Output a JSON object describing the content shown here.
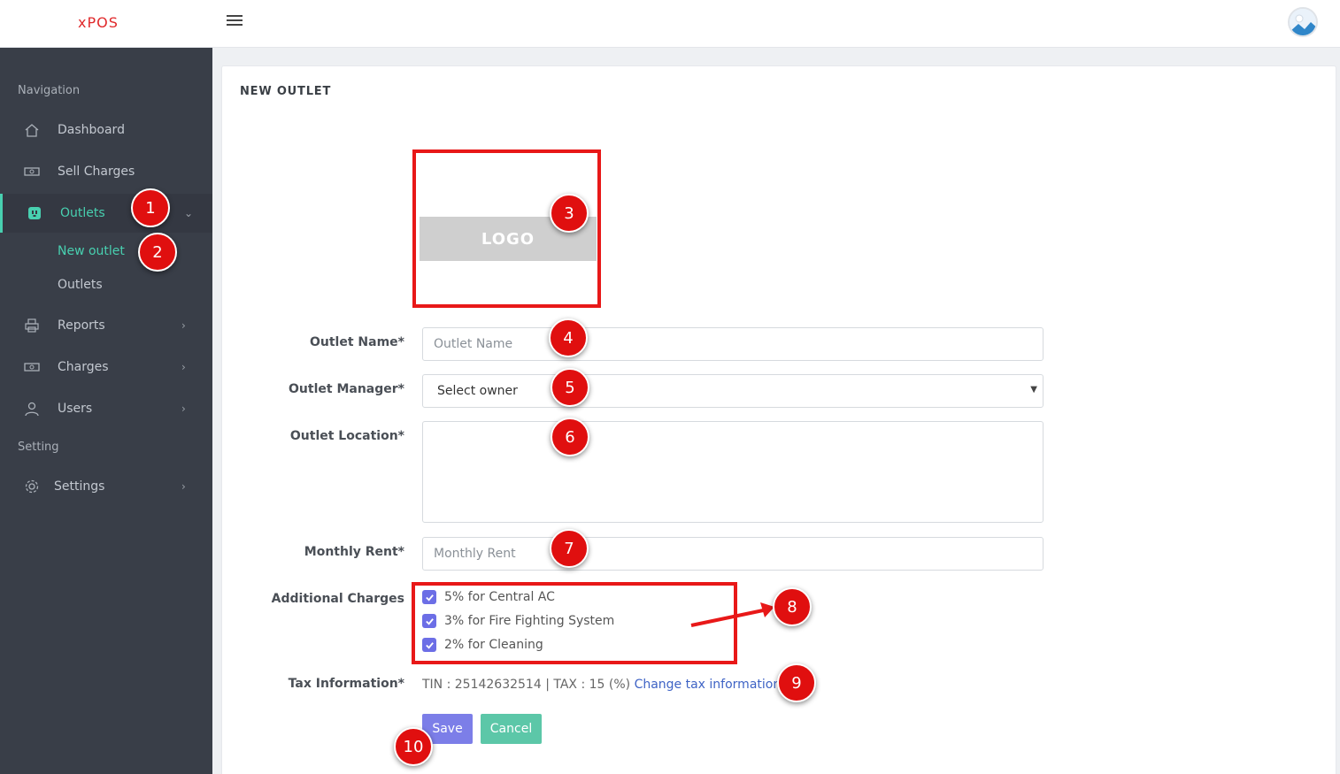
{
  "header": {
    "brand": "xPOS",
    "menu_icon": "hamburger-icon",
    "avatar_icon": "image-avatar-icon"
  },
  "sidebar": {
    "section_navigation": "Navigation",
    "section_setting": "Setting",
    "items": [
      {
        "label": "Dashboard",
        "icon": "home-icon"
      },
      {
        "label": "Sell Charges",
        "icon": "money-icon"
      },
      {
        "label": "Outlets",
        "icon": "outlet-icon",
        "active": true,
        "expanded": true
      },
      {
        "label": "Reports",
        "icon": "printer-icon"
      },
      {
        "label": "Charges",
        "icon": "money-icon"
      },
      {
        "label": "Users",
        "icon": "user-icon"
      },
      {
        "label": "Settings",
        "icon": "gear-icon"
      }
    ],
    "subitems": [
      {
        "label": "New outlet",
        "active": true
      },
      {
        "label": "Outlets"
      }
    ]
  },
  "form": {
    "title": "NEW OUTLET",
    "logo_text": "LOGO",
    "outlet_name_label": "Outlet Name*",
    "outlet_name_placeholder": "Outlet Name",
    "manager_label": "Outlet Manager*",
    "manager_selected": "Select owner",
    "location_label": "Outlet Location*",
    "rent_label": "Monthly Rent*",
    "rent_placeholder": "Monthly Rent",
    "charges_label": "Additional Charges",
    "charges": [
      {
        "label": "5% for Central AC",
        "checked": true
      },
      {
        "label": "3% for Fire Fighting System",
        "checked": true
      },
      {
        "label": "2% for Cleaning",
        "checked": true
      }
    ],
    "tax_label": "Tax Information*",
    "tax_text": "TIN : 25142632514 | TAX : 15 (%)",
    "tax_link": "Change tax information",
    "save_label": "Save",
    "cancel_label": "Cancel"
  },
  "callouts": [
    "1",
    "2",
    "3",
    "4",
    "5",
    "6",
    "7",
    "8",
    "9",
    "10"
  ],
  "colors": {
    "accent": "#48d0b0",
    "sidebar_bg": "#393e48",
    "callout": "#e00f0f",
    "save_button": "#7c7ee8",
    "cancel_button": "#5cc7a8",
    "link": "#3e63c5"
  }
}
